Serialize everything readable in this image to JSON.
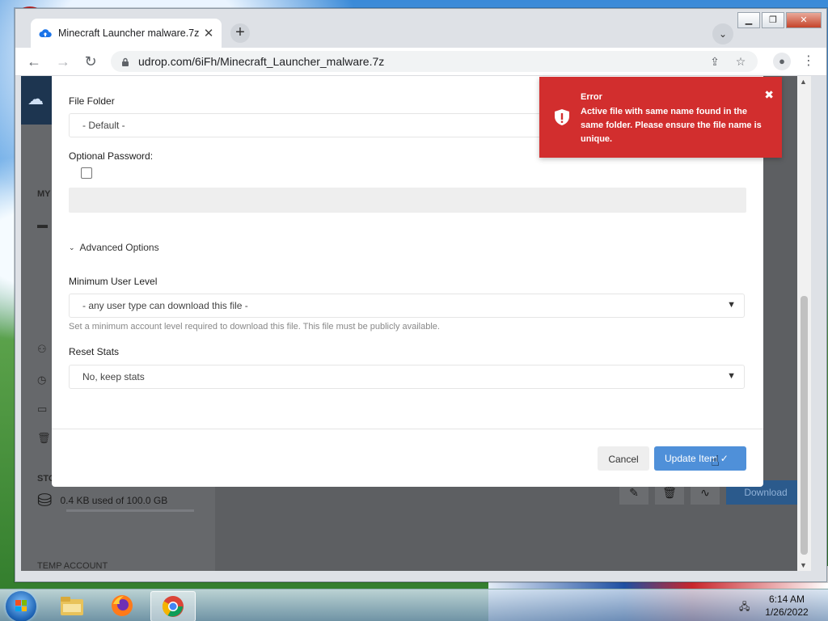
{
  "browser": {
    "tab_title": "Minecraft Launcher malware.7z",
    "url": "udrop.com/6iFh/Minecraft_Launcher_malware.7z"
  },
  "background": {
    "sidebar_my_label": "MY",
    "sidebar_storage_label": "STO",
    "storage_text": "0.4 KB used of 100.0 GB",
    "temp_account_label": "TEMP ACCOUNT",
    "download_label": "Download"
  },
  "modal": {
    "file_folder_label": "File Folder",
    "file_folder_value": "- Default -",
    "optional_password_label": "Optional Password:",
    "advanced_options_label": "Advanced Options",
    "min_user_level_label": "Minimum User Level",
    "min_user_level_value": "- any user type can download this file -",
    "min_user_level_help": "Set a minimum account level required to download this file. This file must be publicly available.",
    "reset_stats_label": "Reset Stats",
    "reset_stats_value": "No, keep stats",
    "cancel_label": "Cancel",
    "update_label": "Update Item ✓"
  },
  "toast": {
    "title": "Error",
    "message": "Active file with same name found in the same folder. Please ensure the file name is unique.",
    "type": "error",
    "color": "#d22e2e"
  },
  "taskbar": {
    "time": "6:14 AM",
    "date": "1/26/2022"
  },
  "colors": {
    "accent": "#4f90d9",
    "error": "#d22e2e"
  }
}
